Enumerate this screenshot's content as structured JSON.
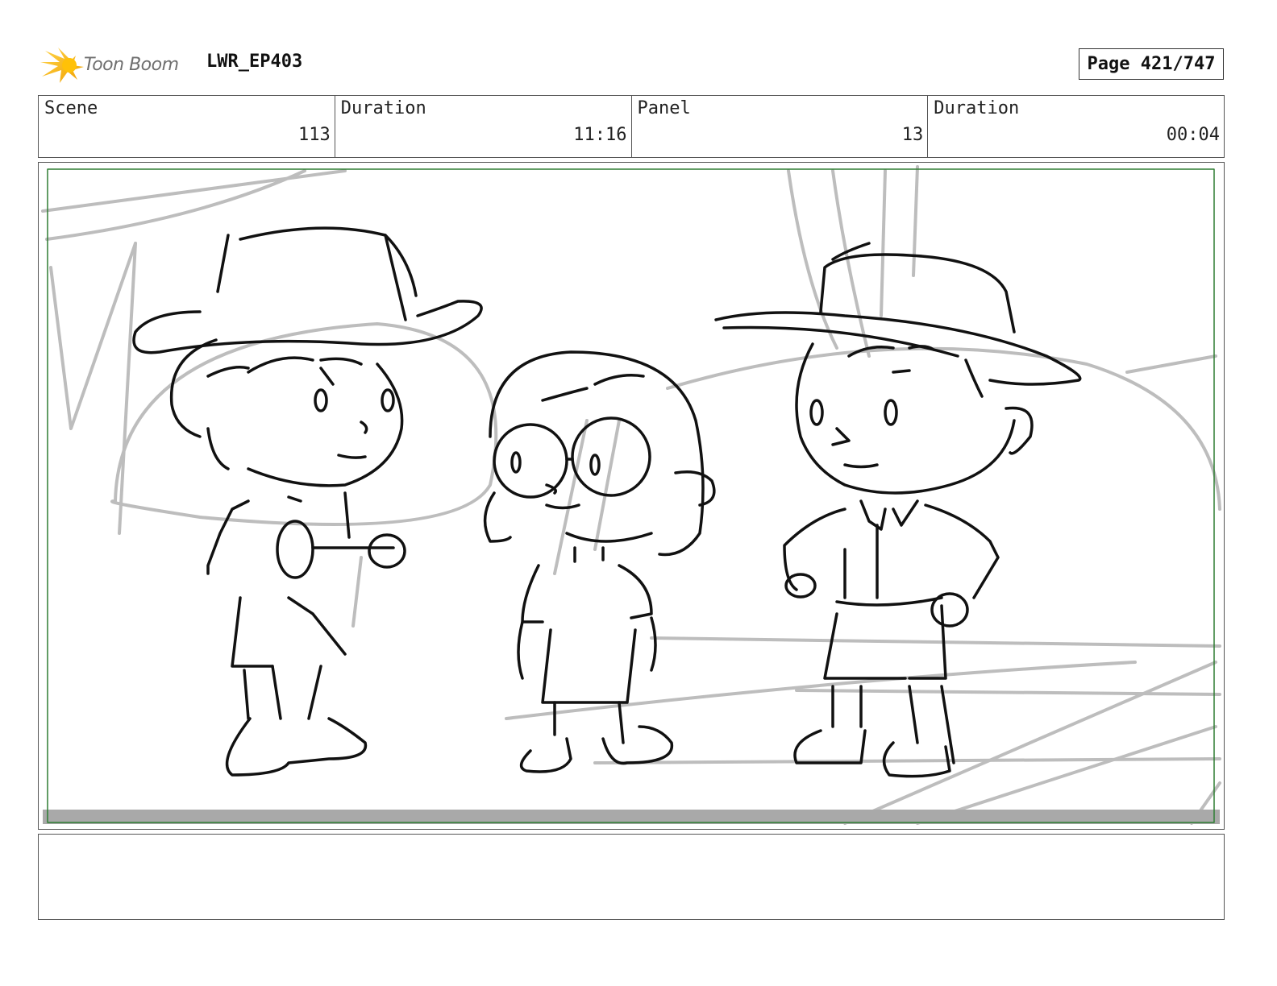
{
  "header": {
    "logo_text": "Toon Boom",
    "project": "LWR_EP403",
    "page_label": "Page 421/747"
  },
  "info": {
    "scene_label": "Scene",
    "scene_value": "113",
    "duration_label": "Duration",
    "duration_value": "11:16",
    "panel_label": "Panel",
    "panel_value": "13",
    "panel_duration_label": "Duration",
    "panel_duration_value": "00:04"
  },
  "panel": {
    "image": "sketch of three children in hats standing together",
    "safe_frame_color": "#2e7d32",
    "sketch_color": "#111111",
    "rough_color": "#bdbdbd"
  },
  "notes": {
    "text": ""
  },
  "icons": {
    "logo": "toon-boom-star-icon"
  }
}
